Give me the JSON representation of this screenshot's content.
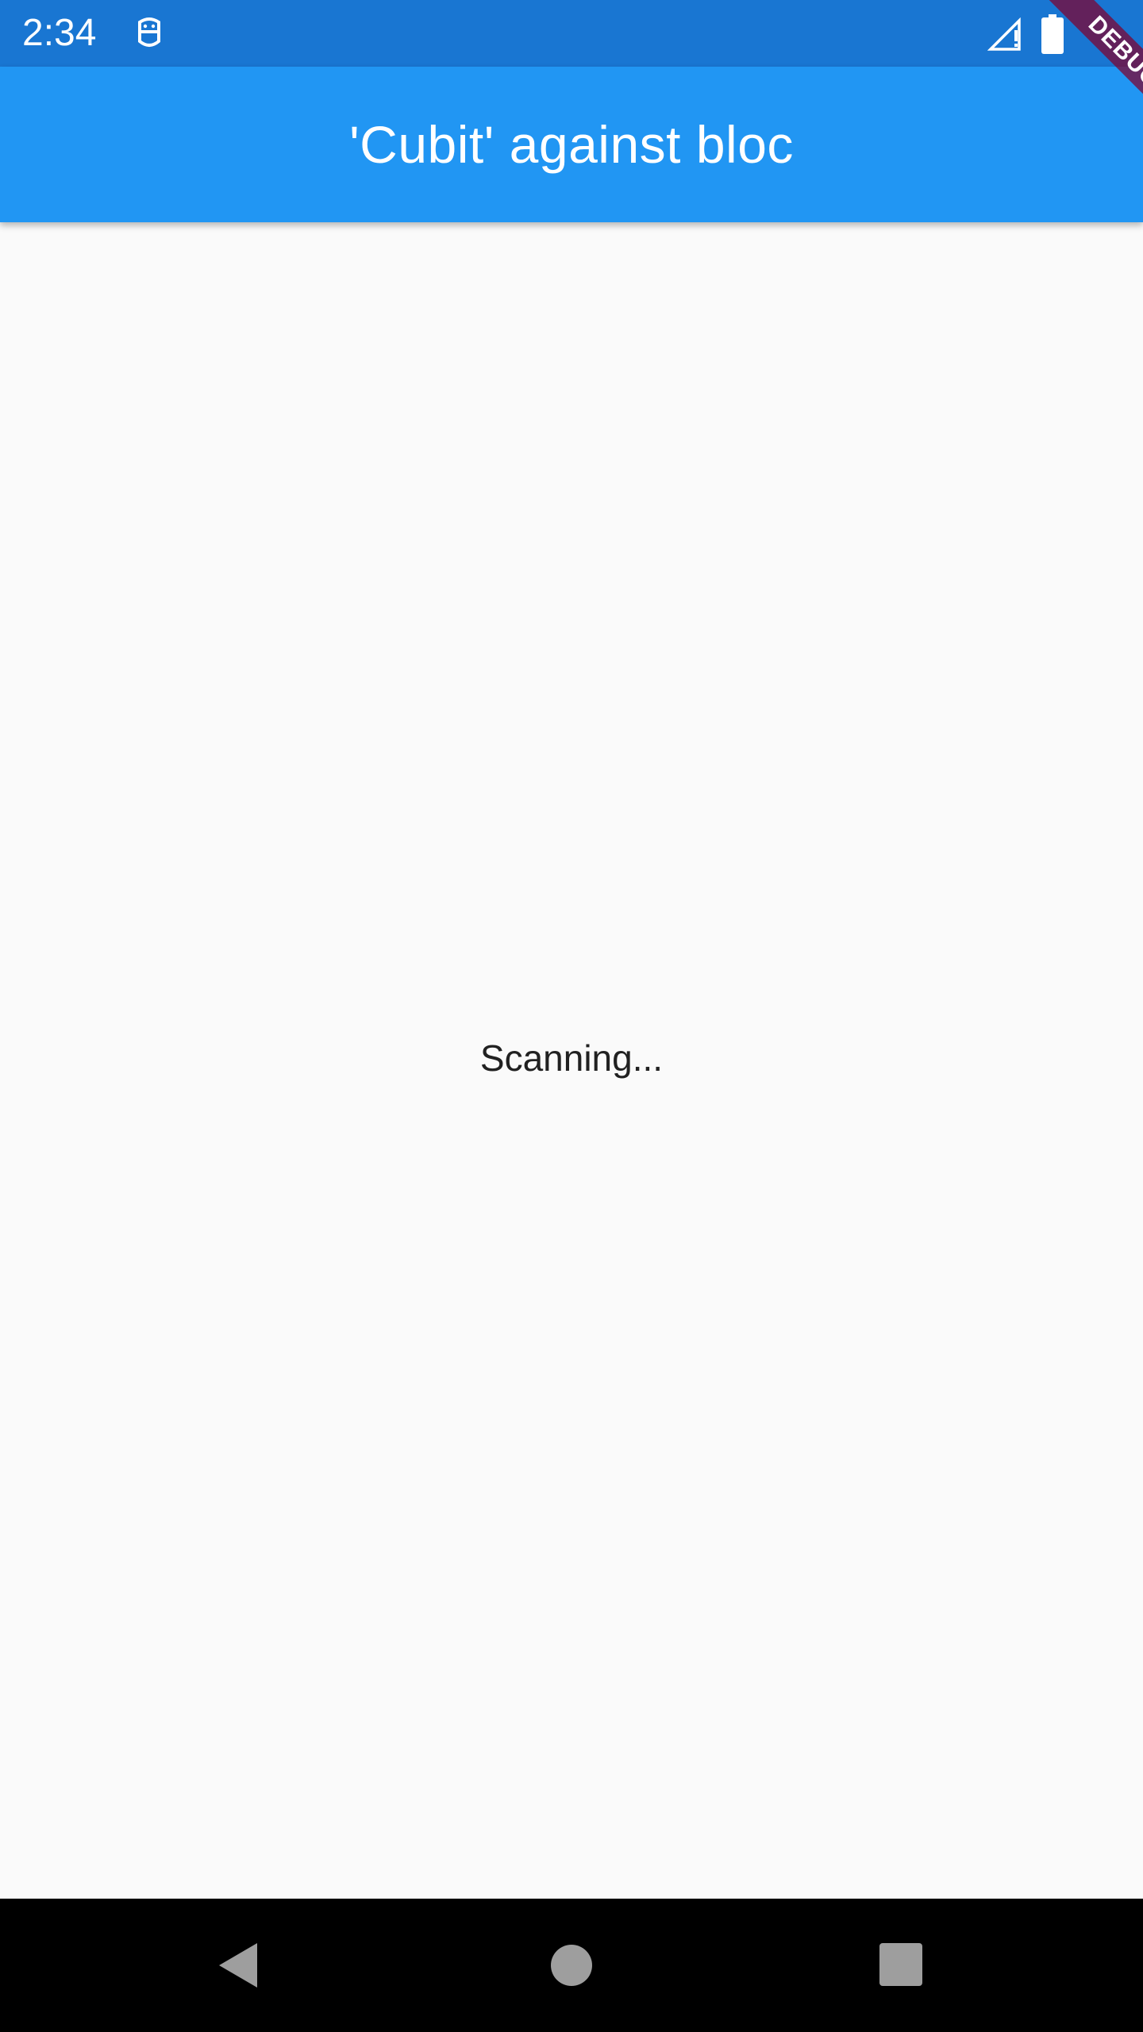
{
  "status_bar": {
    "time": "2:34",
    "icons": [
      "robot-notification-icon",
      "signal-icon",
      "battery-icon"
    ]
  },
  "app_bar": {
    "title": "'Cubit' against bloc"
  },
  "debug_banner": {
    "label": "DEBUG"
  },
  "main": {
    "status_text": "Scanning..."
  },
  "nav_bar": {
    "buttons": [
      "back-icon",
      "home-icon",
      "recents-icon"
    ]
  },
  "colors": {
    "status_bar": "#1976d2",
    "app_bar": "#2196f3",
    "background": "#fafafa",
    "debug_banner": "#80002d",
    "nav_bar": "#000000"
  }
}
